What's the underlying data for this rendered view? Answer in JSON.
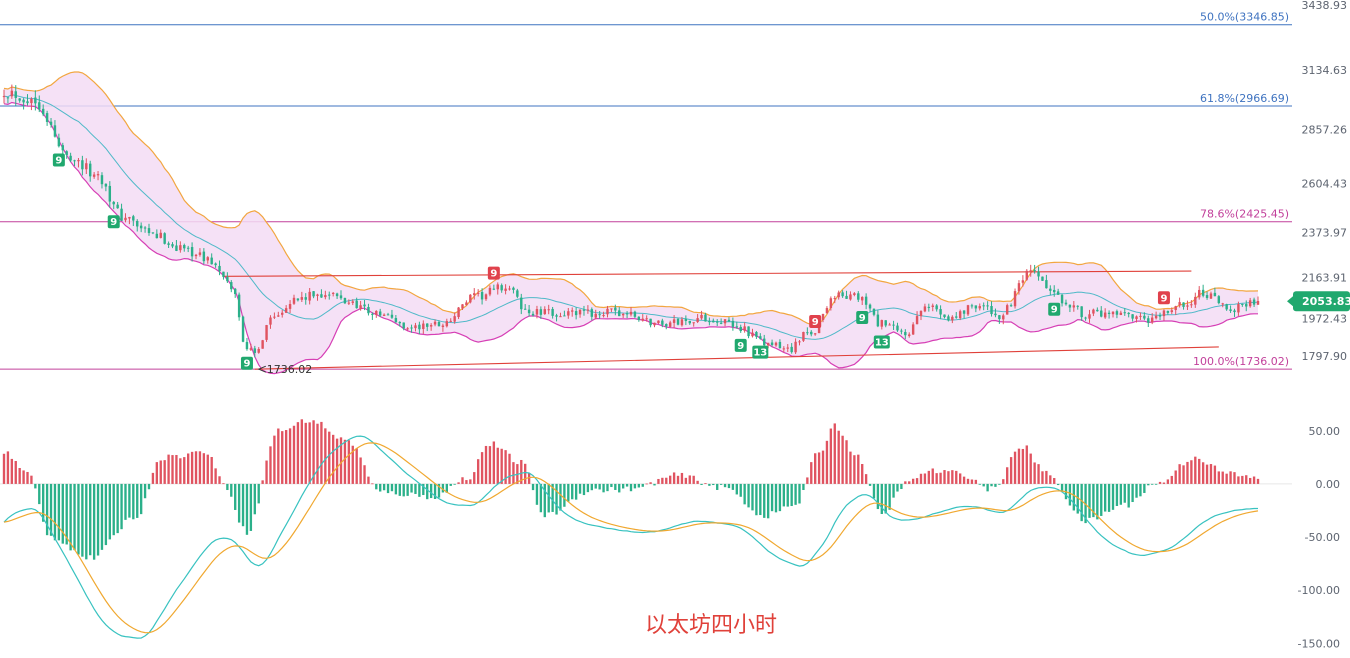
{
  "caption": "以太坊四小时",
  "colors": {
    "up": "#e05360",
    "down": "#2bb08a",
    "band_fill": "#f3dcf5",
    "band_upper": "#f2a640",
    "band_lower": "#d63fb5",
    "band_mid": "#4fb9c8",
    "fib_blue": "#3f73c0",
    "fib_magenta": "#c2409b",
    "trend": "#e0413a",
    "macd_dif": "#38c2c0",
    "macd_dea": "#f0a830",
    "price_tag": "#20a86e",
    "td_up": "#e0414c",
    "td_down": "#20a86e"
  },
  "price_axis": {
    "ticks": [
      "3438.93",
      "3134.63",
      "2857.26",
      "2604.43",
      "2373.97",
      "2163.91",
      "1972.43",
      "1797.90"
    ],
    "range": [
      1690,
      3439
    ]
  },
  "macd_axis": {
    "ticks": [
      "50.00",
      "0.00",
      "-50.00",
      "-100.00",
      "-150.00"
    ],
    "range": [
      -160,
      62
    ]
  },
  "fib_levels": [
    {
      "label": "50.0%(3346.85)",
      "value": 3346.85,
      "color": "blue"
    },
    {
      "label": "61.8%(2966.69)",
      "value": 2966.69,
      "color": "blue"
    },
    {
      "label": "78.6%(2425.45)",
      "value": 2425.45,
      "color": "magenta"
    },
    {
      "label": "100.0%(1736.02)",
      "value": 1736.02,
      "color": "magenta"
    }
  ],
  "current_price": "2053.83",
  "low_label": "1736.02",
  "chart_data": {
    "type": "candlestick",
    "series": [
      {
        "name": "price",
        "anchors": [
          {
            "i": 0,
            "v": 3040
          },
          {
            "i": 8,
            "v": 2990
          },
          {
            "i": 16,
            "v": 2740
          },
          {
            "i": 24,
            "v": 2640
          },
          {
            "i": 30,
            "v": 2450
          },
          {
            "i": 38,
            "v": 2360
          },
          {
            "i": 46,
            "v": 2300
          },
          {
            "i": 52,
            "v": 2250
          },
          {
            "i": 58,
            "v": 2120
          },
          {
            "i": 62,
            "v": 1840
          },
          {
            "i": 64,
            "v": 1800
          },
          {
            "i": 68,
            "v": 1980
          },
          {
            "i": 74,
            "v": 2060
          },
          {
            "i": 82,
            "v": 2090
          },
          {
            "i": 88,
            "v": 2050
          },
          {
            "i": 96,
            "v": 1990
          },
          {
            "i": 104,
            "v": 1930
          },
          {
            "i": 112,
            "v": 1950
          },
          {
            "i": 120,
            "v": 2070
          },
          {
            "i": 128,
            "v": 2120
          },
          {
            "i": 134,
            "v": 2000
          },
          {
            "i": 144,
            "v": 1995
          },
          {
            "i": 156,
            "v": 2000
          },
          {
            "i": 168,
            "v": 1950
          },
          {
            "i": 180,
            "v": 1975
          },
          {
            "i": 188,
            "v": 1930
          },
          {
            "i": 194,
            "v": 1855
          },
          {
            "i": 200,
            "v": 1830
          },
          {
            "i": 206,
            "v": 1910
          },
          {
            "i": 212,
            "v": 2080
          },
          {
            "i": 218,
            "v": 2070
          },
          {
            "i": 224,
            "v": 1945
          },
          {
            "i": 230,
            "v": 1900
          },
          {
            "i": 236,
            "v": 2030
          },
          {
            "i": 242,
            "v": 1980
          },
          {
            "i": 248,
            "v": 2040
          },
          {
            "i": 254,
            "v": 1985
          },
          {
            "i": 262,
            "v": 2180
          },
          {
            "i": 270,
            "v": 2060
          },
          {
            "i": 276,
            "v": 1995
          },
          {
            "i": 284,
            "v": 1985
          },
          {
            "i": 292,
            "v": 1960
          },
          {
            "i": 300,
            "v": 2030
          },
          {
            "i": 306,
            "v": 2090
          },
          {
            "i": 312,
            "v": 2020
          },
          {
            "i": 320,
            "v": 2053
          }
        ]
      },
      {
        "name": "macd",
        "anchors": [
          {
            "i": 0,
            "v": 30
          },
          {
            "i": 6,
            "v": 10
          },
          {
            "i": 12,
            "v": -50
          },
          {
            "i": 22,
            "v": -70
          },
          {
            "i": 34,
            "v": -30
          },
          {
            "i": 40,
            "v": 25
          },
          {
            "i": 52,
            "v": 30
          },
          {
            "i": 56,
            "v": 0
          },
          {
            "i": 62,
            "v": -45
          },
          {
            "i": 70,
            "v": 50
          },
          {
            "i": 78,
            "v": 60
          },
          {
            "i": 88,
            "v": 40
          },
          {
            "i": 96,
            "v": -8
          },
          {
            "i": 110,
            "v": -12
          },
          {
            "i": 118,
            "v": 5
          },
          {
            "i": 124,
            "v": 38
          },
          {
            "i": 132,
            "v": 20
          },
          {
            "i": 138,
            "v": -30
          },
          {
            "i": 150,
            "v": -6
          },
          {
            "i": 160,
            "v": -5
          },
          {
            "i": 172,
            "v": 8
          },
          {
            "i": 184,
            "v": -4
          },
          {
            "i": 194,
            "v": -30
          },
          {
            "i": 202,
            "v": -20
          },
          {
            "i": 208,
            "v": 30
          },
          {
            "i": 212,
            "v": 55
          },
          {
            "i": 218,
            "v": 25
          },
          {
            "i": 224,
            "v": -30
          },
          {
            "i": 230,
            "v": 0
          },
          {
            "i": 236,
            "v": 12
          },
          {
            "i": 244,
            "v": 10
          },
          {
            "i": 252,
            "v": -5
          },
          {
            "i": 260,
            "v": 35
          },
          {
            "i": 266,
            "v": 10
          },
          {
            "i": 276,
            "v": -35
          },
          {
            "i": 286,
            "v": -20
          },
          {
            "i": 294,
            "v": 0
          },
          {
            "i": 304,
            "v": 25
          },
          {
            "i": 312,
            "v": 10
          },
          {
            "i": 320,
            "v": 5
          }
        ]
      }
    ],
    "td_markers": [
      {
        "i": 14,
        "label": "9",
        "type": "down"
      },
      {
        "i": 28,
        "label": "9",
        "type": "down"
      },
      {
        "i": 62,
        "label": "9",
        "type": "down"
      },
      {
        "i": 125,
        "label": "9",
        "type": "up"
      },
      {
        "i": 188,
        "label": "9",
        "type": "down"
      },
      {
        "i": 193,
        "label": "13",
        "type": "down"
      },
      {
        "i": 207,
        "label": "9",
        "type": "up"
      },
      {
        "i": 219,
        "label": "9",
        "type": "down"
      },
      {
        "i": 224,
        "label": "13",
        "type": "down"
      },
      {
        "i": 268,
        "label": "9",
        "type": "down"
      },
      {
        "i": 296,
        "label": "9",
        "type": "up"
      }
    ],
    "trendlines": [
      {
        "from": {
          "i": 56,
          "v": 2170
        },
        "to": {
          "i": 303,
          "v": 2195
        }
      },
      {
        "from": {
          "i": 64,
          "v": 1736
        },
        "to": {
          "i": 310,
          "v": 1840
        }
      }
    ]
  }
}
